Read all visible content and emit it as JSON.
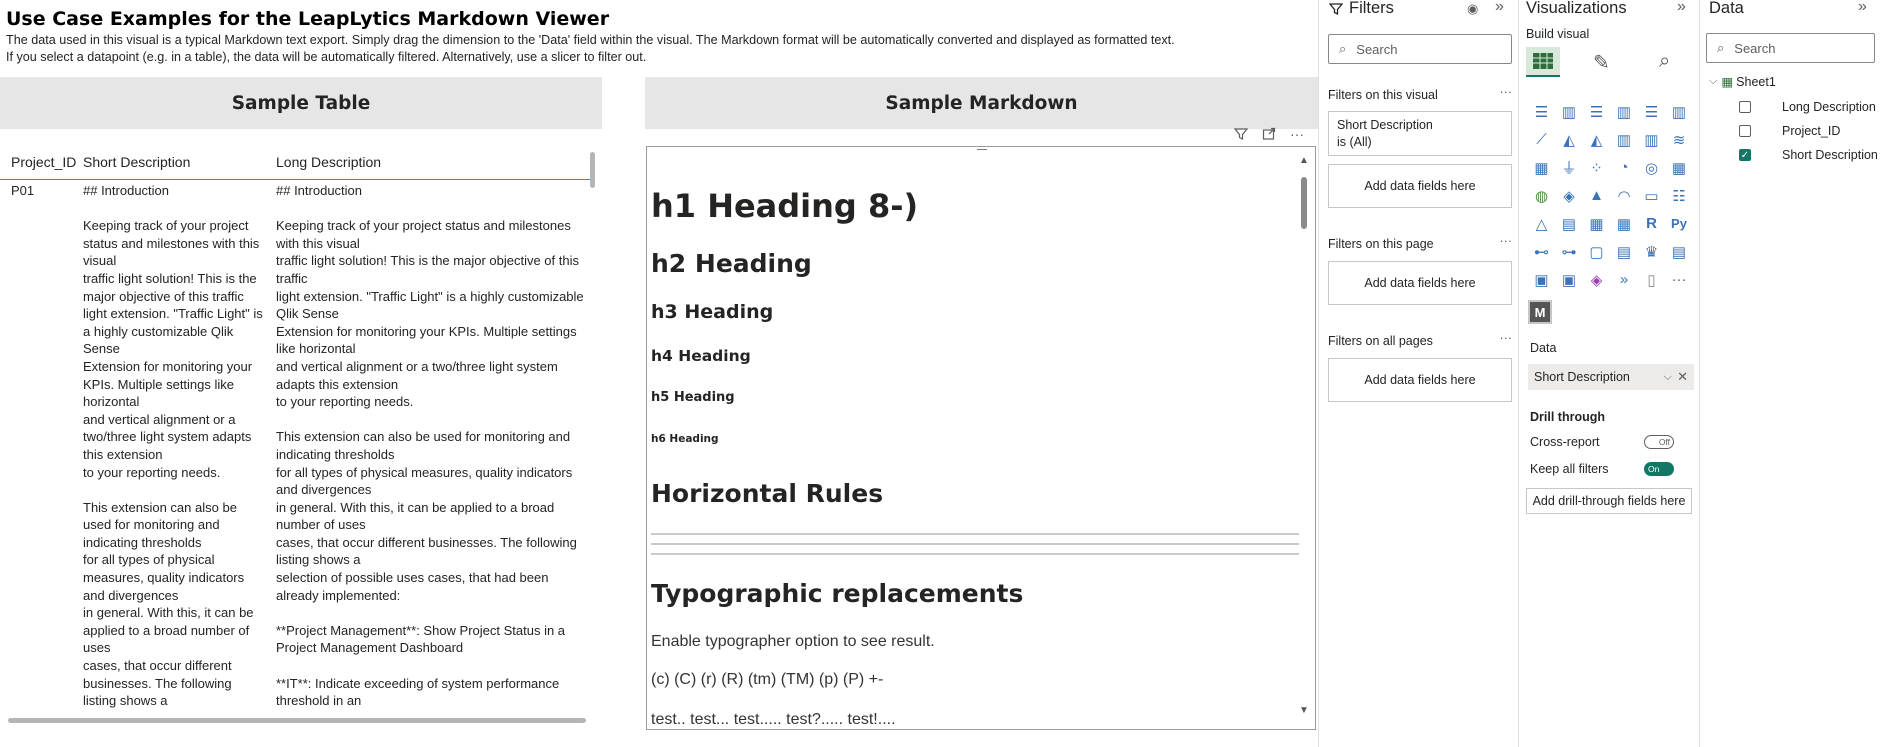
{
  "report": {
    "title": "Use Case Examples for the LeapLytics Markdown Viewer",
    "description_line1": "The data used in this visual is a typical Markdown text export. Simply drag the dimension to the 'Data' field within the visual. The Markdown format will be automatically converted and displayed as formatted text.",
    "description_line2": "If you select a datapoint (e.g. in a table), the data will be automatically filtered. Alternatively, use a slicer to filter out."
  },
  "sample_table": {
    "header": "Sample Table",
    "columns": [
      "Project_ID",
      "Short Description",
      "Long Description"
    ],
    "rows": [
      {
        "project_id": "P01",
        "short": "## Introduction\n\nKeeping track of your project status and milestones with this visual\ntraffic light solution! This is the major objective of this traffic\nlight extension. \"Traffic Light\" is a highly customizable Qlik Sense\nExtension for monitoring your KPIs. Multiple settings like horizontal\nand vertical alignment or a two/three light system adapts this extension\nto your reporting needs.\n\nThis extension can also be used for monitoring and indicating thresholds\nfor all types of physical measures, quality indicators and divergences\nin general. With this, it can be applied to a broad number of uses\ncases, that occur different businesses. The following listing shows a",
        "long": "## Introduction\n\nKeeping track of your project status and milestones with this visual\ntraffic light solution! This is the major objective of this traffic\nlight extension. \"Traffic Light\" is a highly customizable Qlik Sense\nExtension for monitoring your KPIs. Multiple settings like horizontal\nand vertical alignment or a two/three light system adapts this extension\nto your reporting needs.\n\nThis extension can also be used for monitoring and indicating thresholds\nfor all types of physical measures, quality indicators and divergences\nin general. With this, it can be applied to a broad number of uses\ncases, that occur different businesses. The following listing shows a\nselection of possible uses cases, that had been already implemented:\n\n**Project Management**: Show Project Status in a Project Management Dashboard\n\n**IT**: Indicate exceeding of system performance threshold in an"
      }
    ]
  },
  "sample_markdown": {
    "header": "Sample Markdown",
    "h1": "h1 Heading 8-)",
    "h2": "h2 Heading",
    "h3": "h3 Heading",
    "h4": "h4 Heading",
    "h5": "h5 Heading",
    "h6": "h6 Heading",
    "rules_heading": "Horizontal Rules",
    "typo_heading": "Typographic replacements",
    "p1": "Enable typographer option to see result.",
    "p2": "(c) (C) (r) (R) (tm) (TM) (p) (P) +-",
    "p3": "test.. test... test..... test?..... test!...."
  },
  "filters_pane": {
    "title": "Filters",
    "search_placeholder": "Search",
    "on_visual": "Filters on this visual",
    "visual_filter_field": "Short Description",
    "visual_filter_value": "is (All)",
    "add_fields": "Add data fields here",
    "on_page": "Filters on this page",
    "on_all_pages": "Filters on all pages",
    "more": "..."
  },
  "viz_pane": {
    "title": "Visualizations",
    "build_visual": "Build visual",
    "data_label": "Data",
    "data_field": "Short Description",
    "drill_through": "Drill through",
    "cross_report": "Cross-report",
    "cross_report_state": "Off",
    "keep_filters": "Keep all filters",
    "keep_filters_state": "On",
    "add_drill": "Add drill-through fields here",
    "custom_visual_letter": "M",
    "r_label": "R",
    "py_label": "Py",
    "more": "···"
  },
  "data_pane": {
    "title": "Data",
    "search_placeholder": "Search",
    "table": "Sheet1",
    "fields": [
      {
        "name": "Long Description",
        "checked": false
      },
      {
        "name": "Project_ID",
        "checked": false
      },
      {
        "name": "Short Description",
        "checked": true
      }
    ]
  }
}
